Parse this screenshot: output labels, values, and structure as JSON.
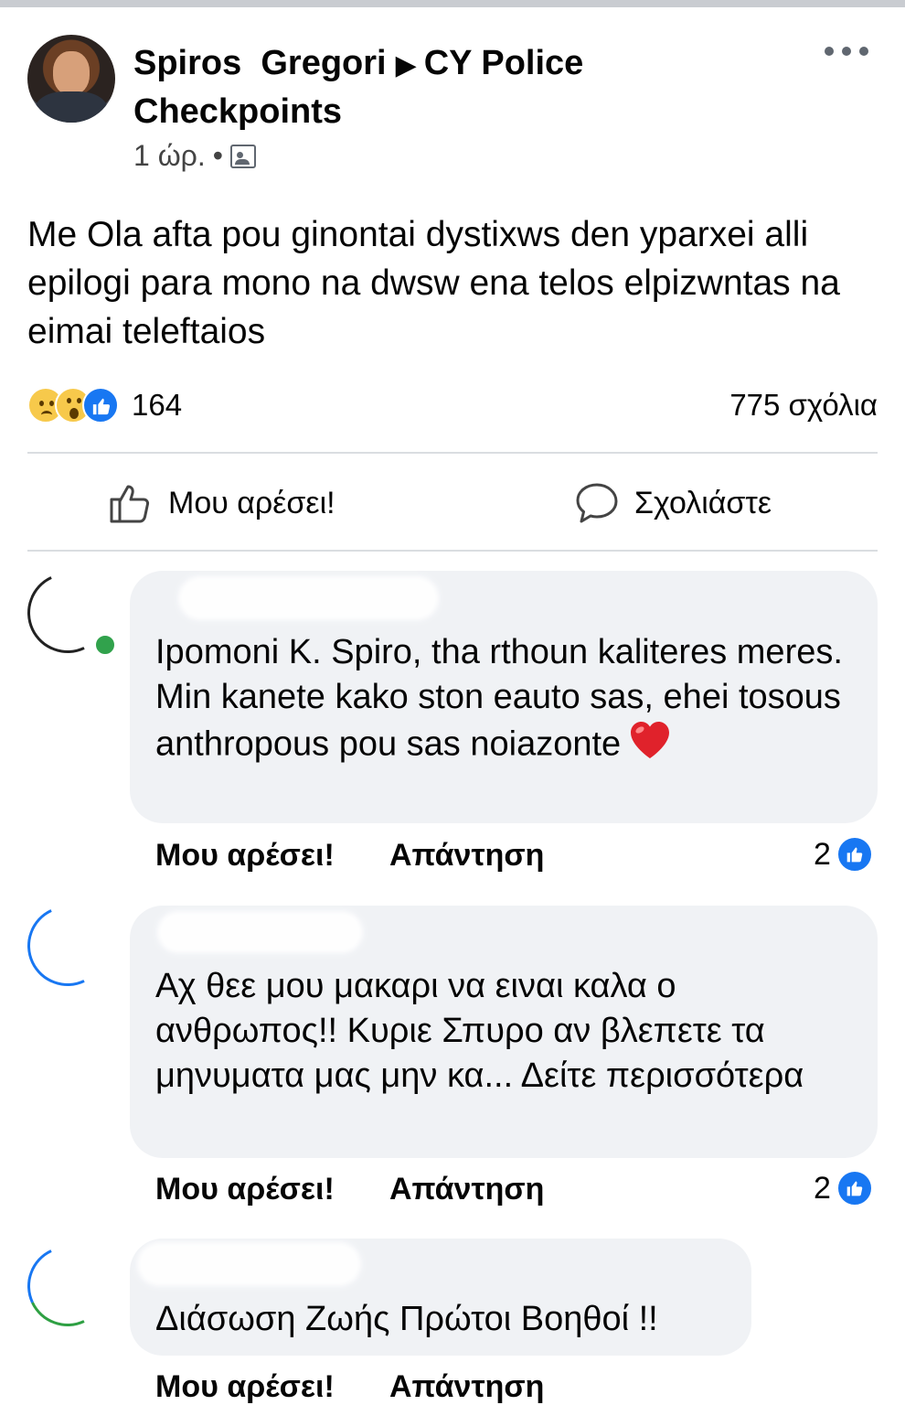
{
  "post": {
    "author": "Spiros  Gregori",
    "group": "CY Police Checkpoints",
    "time": "1 ώρ.",
    "separator": "•",
    "text": "Me Ola afta pou ginontai dystixws den yparxei alli epilogi para mono na dwsw ena telos elpizwntas na eimai teleftaios",
    "reaction_count": "164",
    "comment_count": "775 σχόλια",
    "reaction_icons": [
      "sad-icon",
      "wow-icon",
      "like-icon"
    ]
  },
  "actions": {
    "like_label": "Μου αρέσει!",
    "comment_label": "Σχολιάστε"
  },
  "comments": [
    {
      "text": "Ipomoni K. Spiro, tha rthoun kaliteres meres. Min kanete kako ston eauto sas, ehei tosous anthropous pou sas noiazonte",
      "emoji": "heart-icon",
      "like_label": "Μου αρέσει!",
      "reply_label": "Απάντηση",
      "likes": "2"
    },
    {
      "text": "Αχ θεε μου μακαρι να ειναι καλα ο ανθρωπος!! Κυριε Σπυρο αν βλεπετε τα μηνυματα μας μην κα... Δείτε περισσότερα",
      "like_label": "Μου αρέσει!",
      "reply_label": "Απάντηση",
      "likes": "2"
    },
    {
      "text": "Διάσωση Ζωής Πρώτοι Βοηθοί !!",
      "like_label": "Μου αρέσει!",
      "reply_label": "Απάντηση"
    }
  ],
  "colors": {
    "accent": "#1877f2",
    "bubble": "#f0f2f5",
    "online": "#31a24c",
    "divider": "#dadde1"
  }
}
